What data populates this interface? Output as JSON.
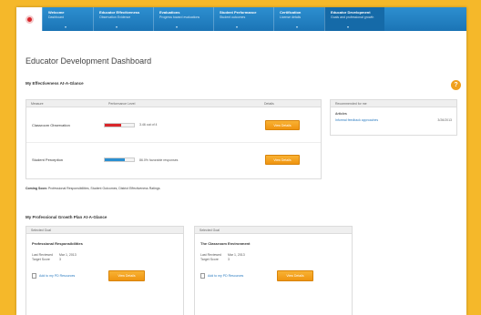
{
  "nav": {
    "tabs": [
      {
        "title": "Welcome",
        "subtitle": "Dashboard"
      },
      {
        "title": "Educator Effectiveness",
        "subtitle": "Observation Evidence"
      },
      {
        "title": "Evaluations",
        "subtitle": "Progress toward evaluations"
      },
      {
        "title": "Student Performance",
        "subtitle": "Student outcomes"
      },
      {
        "title": "Certification",
        "subtitle": "License details"
      },
      {
        "title": "Educator Development",
        "subtitle": "Goals and professional growth"
      }
    ]
  },
  "header": {
    "title": "Educator Development Dashboard",
    "help_label": "?"
  },
  "effectiveness": {
    "section_title": "My Effectiveness At-A-Glance",
    "columns": [
      "Measure",
      "Performance Level",
      "Details"
    ],
    "rows": [
      {
        "name": "Classroom Observation",
        "level_text": "3.46 out of 4",
        "level": 0.55,
        "color": "#d9262b",
        "button": "View Details"
      },
      {
        "name": "Student Perception",
        "level_text": "86.0% favorable responses",
        "level": 0.7,
        "color": "#2b8fd1",
        "button": "View Details"
      }
    ]
  },
  "recent": {
    "header": "Recommended for me",
    "category": "Articles",
    "item_link": "Informal feedback approaches",
    "item_date": "3/26/2013"
  },
  "coming_soon": {
    "label": "Coming Soon:",
    "text": "Professional Responsibilities, Student Outcomes, District Effectiveness Ratings"
  },
  "goals": {
    "section_title": "My Professional Growth Plan At-A-Glance",
    "panels": [
      {
        "header": "Selected Goal",
        "title": "Professional Responsibilities",
        "last_reviewed_label": "Last Reviewed",
        "last_reviewed": "Mar 1, 2013",
        "target_score_label": "Target Score",
        "target_score": "3",
        "link": "Add to my PD Resources",
        "button": "View Details"
      },
      {
        "header": "Selected Goal",
        "title": "The Classroom Environment",
        "last_reviewed_label": "Last Reviewed",
        "last_reviewed": "Mar 1, 2013",
        "target_score_label": "Target Score",
        "target_score": "3",
        "link": "Add to my PD Resources",
        "button": "View Details"
      }
    ]
  }
}
